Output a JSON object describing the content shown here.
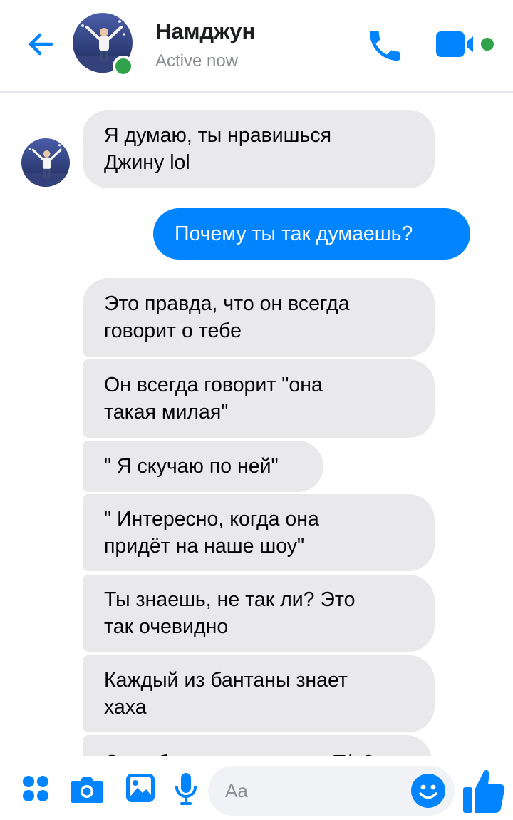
{
  "header": {
    "contact_name": "Намджун",
    "status": "Active now"
  },
  "messages": [
    {
      "direction": "in",
      "lines": [
        "Я думаю, ты нравишься",
        "Джину lol"
      ]
    },
    {
      "direction": "out",
      "lines": [
        "Почему ты так думаешь?"
      ]
    },
    {
      "direction": "in",
      "lines": [
        "Это правда, что он всегда",
        "говорит о тебе"
      ]
    },
    {
      "direction": "in",
      "lines": [
        "Он всегда говорит \"она",
        "такая милая\""
      ]
    },
    {
      "direction": "in",
      "lines": [
        "\" Я скучаю по ней\""
      ]
    },
    {
      "direction": "in",
      "lines": [
        "\" Интересно, когда она",
        "придёт на наше шоу\""
      ]
    },
    {
      "direction": "in",
      "lines": [
        "Ты знаешь, не так ли? Это",
        "так очевидно"
      ]
    },
    {
      "direction": "in",
      "lines": [
        "Каждый из бантаны знает",
        "хаха"
      ]
    },
    {
      "direction": "in",
      "lines": [
        "Он тебе тоже нравится, Т/и?"
      ]
    }
  ],
  "composer": {
    "placeholder": "Aa"
  },
  "colors": {
    "accent": "#0084ff",
    "incoming_bubble": "#e9e9eb",
    "active_green": "#31a24c"
  },
  "icons": {
    "back": "arrow-left-icon",
    "call": "phone-icon",
    "video": "video-camera-icon",
    "more": "four-dots-icon",
    "camera": "camera-icon",
    "gallery": "image-icon",
    "voice": "microphone-icon",
    "emoji": "smiley-icon",
    "like": "thumbs-up-icon"
  }
}
